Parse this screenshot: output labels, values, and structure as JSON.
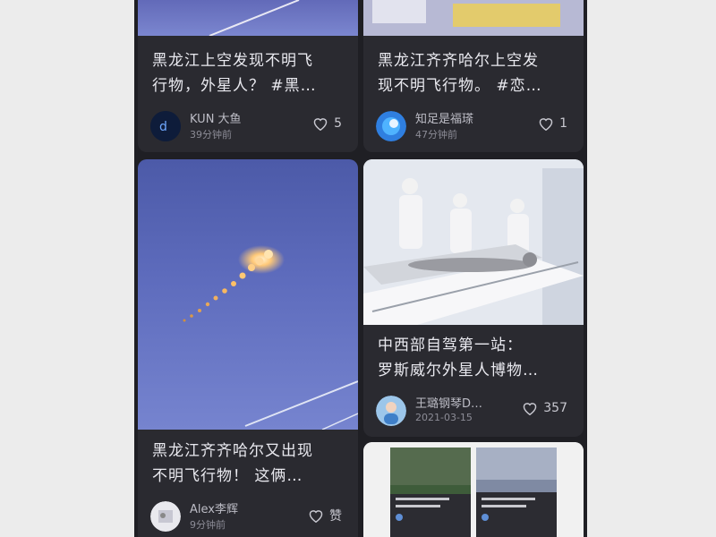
{
  "cards": [
    {
      "title": "黑龙江上空发现不明飞\n行物，外星人？ #黑…",
      "author": "KUN 大鱼",
      "time": "39分钟前",
      "likes": "5"
    },
    {
      "title": "黑龙江齐齐哈尔上空发\n现不明飞行物。 #恋…",
      "author": "知足是福瑹",
      "time": "47分钟前",
      "likes": "1"
    },
    {
      "title": "黑龙江齐齐哈尔又出现\n不明飞行物！ 这俩…",
      "author": "Alex李辉",
      "time": "9分钟前",
      "likes": "赞"
    },
    {
      "title": "中西部自驾第一站：\n罗斯威尔外星人博物…",
      "author": "王璐钢琴D…",
      "time": "2021-03-15",
      "likes": "357"
    }
  ],
  "colors": {
    "feed_bg": "#1f1f24",
    "card_bg": "#2a2a30",
    "sky_blue": "#5b6bb8",
    "ufo_glow": "#ffd089"
  }
}
